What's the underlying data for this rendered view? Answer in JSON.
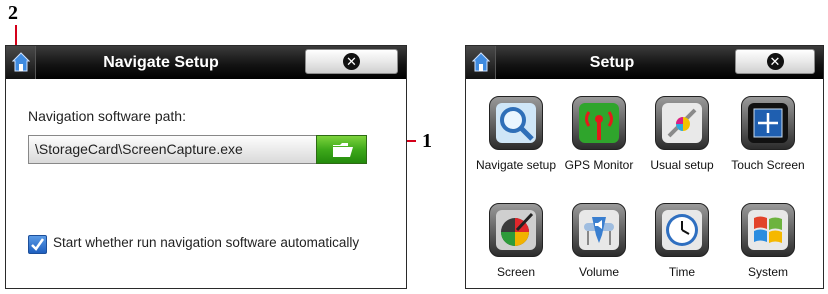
{
  "callouts": {
    "one": "1",
    "two": "2"
  },
  "left_window": {
    "title": "Navigate Setup",
    "path_label": "Navigation software path:",
    "path_value": "\\StorageCard\\ScreenCapture.exe",
    "checkbox_label": "Start whether run navigation software automatically",
    "checkbox_checked": true
  },
  "right_window": {
    "title": "Setup",
    "items": [
      {
        "label": "Navigate setup",
        "icon": "magnifier-icon"
      },
      {
        "label": "GPS Monitor",
        "icon": "gps-antenna-icon"
      },
      {
        "label": "Usual setup",
        "icon": "tools-icon"
      },
      {
        "label": "Touch Screen",
        "icon": "touch-screen-icon"
      },
      {
        "label": "Screen",
        "icon": "palette-icon"
      },
      {
        "label": "Volume",
        "icon": "speaker-icon"
      },
      {
        "label": "Time",
        "icon": "clock-icon"
      },
      {
        "label": "System",
        "icon": "windows-logo-icon"
      }
    ]
  },
  "colors": {
    "callout_line": "#d4001a",
    "folder_button": "#3ea91a",
    "checkbox": "#1e5fbf"
  }
}
